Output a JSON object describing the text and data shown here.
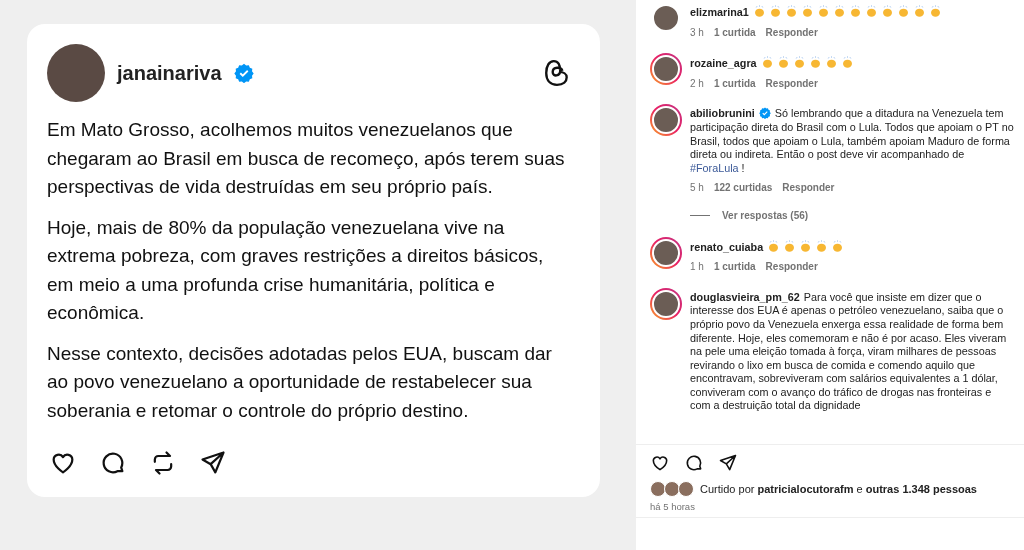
{
  "post": {
    "username": "janainariva",
    "verified": true,
    "paragraphs": [
      "Em Mato Grosso, acolhemos muitos venezuelanos que chegaram ao Brasil em busca de recomeço, após terem suas perspectivas de vida destruídas em seu próprio país.",
      "Hoje, mais de 80% da população venezuelana vive na extrema pobreza, com graves restrições a direitos básicos, em meio a uma profunda crise humanitária, política e econômica.",
      "Nesse contexto, decisões adotadas pelos EUA, buscam dar ao povo venezuelano a oportunidade de restabelecer sua soberania e retomar o controle do próprio destino."
    ]
  },
  "comments": [
    {
      "username": "elizmarina1",
      "story_ring": false,
      "reactions": [
        {
          "kind": "clap"
        },
        {
          "kind": "clap"
        },
        {
          "kind": "clap"
        },
        {
          "kind": "clap"
        },
        {
          "kind": "clap"
        },
        {
          "kind": "clap"
        },
        {
          "kind": "clap"
        },
        {
          "kind": "clap"
        },
        {
          "kind": "clap"
        },
        {
          "kind": "clap"
        },
        {
          "kind": "clap"
        },
        {
          "kind": "clap"
        }
      ],
      "time": "3 h",
      "likes": "1 curtida",
      "reply": "Responder"
    },
    {
      "username": "rozaine_agra",
      "story_ring": true,
      "reactions": [
        {
          "kind": "clap"
        },
        {
          "kind": "clap"
        },
        {
          "kind": "clap"
        },
        {
          "kind": "clap"
        },
        {
          "kind": "clap"
        },
        {
          "kind": "clap"
        }
      ],
      "time": "2 h",
      "likes": "1 curtida",
      "reply": "Responder"
    },
    {
      "username": "abiliobrunini",
      "verified": true,
      "story_ring": true,
      "text": "Só lembrando que a ditadura na Venezuela tem participação direta do Brasil com o Lula. Todos que apoiam o PT no Brasil, todos que apoiam o Lula, também apoiam Maduro de forma direta ou indireta. Então o post deve vir acompanhado de",
      "hashtag": "#ForaLula",
      "after": " !",
      "time": "5 h",
      "likes": "122 curtidas",
      "reply": "Responder",
      "replies": "Ver respostas (56)"
    },
    {
      "username": "renato_cuiaba",
      "story_ring": true,
      "reactions": [
        {
          "kind": "clap"
        },
        {
          "kind": "clap"
        },
        {
          "kind": "clap"
        },
        {
          "kind": "clap"
        },
        {
          "kind": "clap"
        }
      ],
      "time": "1 h",
      "likes": "1 curtida",
      "reply": "Responder"
    },
    {
      "username": "douglasvieira_pm_62",
      "story_ring": true,
      "text": "Para você que insiste em dizer que o interesse dos EUA é apenas o petróleo venezuelano, saiba que o próprio povo da Venezuela enxerga essa realidade de forma bem diferente. Hoje, eles comemoram e não é por acaso. Eles viveram na pele uma eleição tomada à força, viram milhares de pessoas revirando o lixo em busca de comida e comendo aquilo que encontravam, sobreviveram com salários equivalentes a 1 dólar, conviveram com o avanço do tráfico de drogas nas fronteiras e com a destruição total da dignidade"
    }
  ],
  "likes_summary": {
    "prefix": "Curtido por",
    "user": "patricialocutorafm",
    "middle": "e",
    "others": "outras 1.348 pessoas"
  },
  "posted": "há 5 horas"
}
